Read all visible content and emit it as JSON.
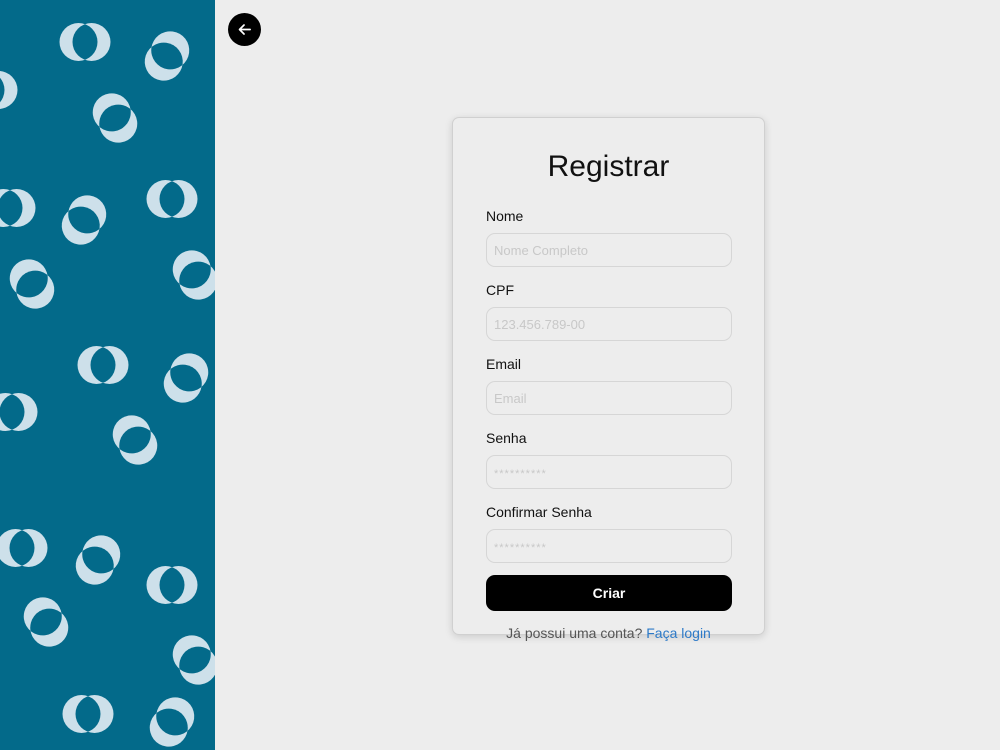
{
  "colors": {
    "panel_bg": "#036a8a",
    "panel_circles": "#cde0ea",
    "page_bg": "#ededed",
    "button_bg": "#000000",
    "link": "#2d7ac8"
  },
  "back_button": {
    "icon": "arrow-left-icon"
  },
  "form": {
    "title": "Registrar",
    "fields": [
      {
        "label": "Nome",
        "placeholder": "Nome Completo",
        "value": ""
      },
      {
        "label": "CPF",
        "placeholder": "123.456.789-00",
        "value": ""
      },
      {
        "label": "Email",
        "placeholder": "Email",
        "value": ""
      },
      {
        "label": "Senha",
        "placeholder": "**********",
        "value": ""
      },
      {
        "label": "Confirmar Senha",
        "placeholder": "**********",
        "value": ""
      }
    ],
    "submit_label": "Criar",
    "login_prompt": "Já possui uma conta?",
    "login_link": "Faça login"
  }
}
